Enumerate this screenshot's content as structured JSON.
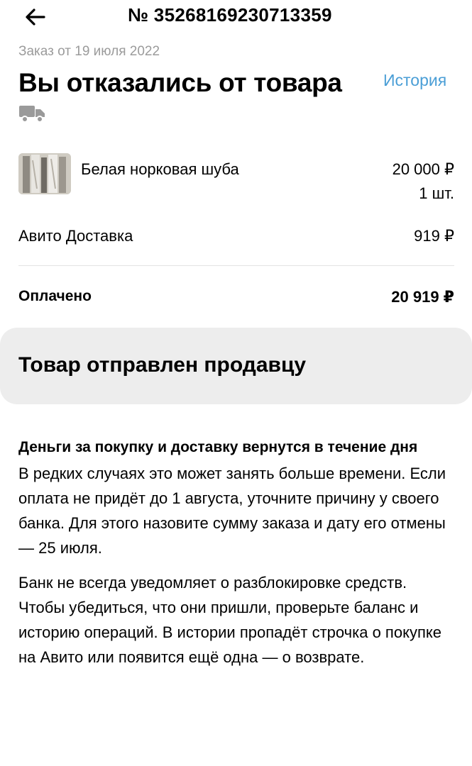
{
  "header": {
    "order_number": "№ 35268169230713359",
    "back_icon": "arrow-left-icon"
  },
  "order": {
    "date": "Заказ от 19 июля 2022",
    "status_title": "Вы отказались от товара",
    "history_label": "История",
    "delivery_icon": "truck-icon"
  },
  "item": {
    "name": "Белая норковая шуба",
    "price": "20 000 ₽",
    "quantity": "1 шт."
  },
  "delivery": {
    "label": "Авито Доставка",
    "price": "919 ₽"
  },
  "payment": {
    "label": "Оплачено",
    "total": "20 919 ₽"
  },
  "status_card": {
    "title": "Товар отправлен продавцу"
  },
  "refund_info": {
    "heading": "Деньги за покупку и доставку вернутся в течение дня",
    "paragraph1": "В редких случаях это может занять больше времени. Если оплата не придёт до 1 августа, уточните причину у своего банка. Для этого назовите сумму заказа и дату его отмены — 25 июля.",
    "paragraph2": "Банк не всегда уведомляет о разблокировке средств. Чтобы убедиться, что они пришли, проверьте баланс и историю операций. В истории пропадёт строчка о покупке на Авито или появится ещё одна — о возврате."
  },
  "colors": {
    "accent_link": "#4a9ed6",
    "muted_text": "#9b9b9b",
    "card_bg": "#ededed",
    "icon_gray": "#9a9a9a"
  }
}
